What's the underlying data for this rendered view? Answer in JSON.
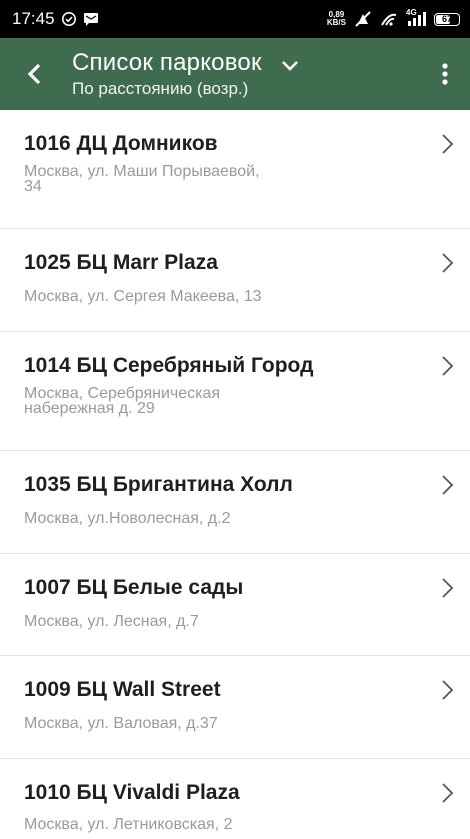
{
  "status_bar": {
    "time": "17:45",
    "net_speed_value": "0,89",
    "net_speed_unit": "KB/S",
    "signal_label": "4G",
    "battery": "67"
  },
  "appbar": {
    "title": "Список парковок",
    "subtitle": "По расстоянию (возр.)"
  },
  "parkings": [
    {
      "name": "1016 ДЦ Домников",
      "address_line1": "Москва, ул. Маши Порываевой,",
      "address_line2": "34"
    },
    {
      "name": "1025 БЦ Marr Plaza",
      "address_line1": "Москва, ул. Сергея Макеева, 13",
      "address_line2": ""
    },
    {
      "name": "1014 БЦ Серебряный Город",
      "address_line1": "Москва, Серебряническая",
      "address_line2": "набережная д. 29"
    },
    {
      "name": "1035 БЦ Бригантина Холл",
      "address_line1": "Москва, ул.Новолесная, д.2",
      "address_line2": ""
    },
    {
      "name": "1007 БЦ Белые сады",
      "address_line1": "Москва, ул. Лесная, д.7",
      "address_line2": ""
    },
    {
      "name": "1009 БЦ Wall Street",
      "address_line1": "Москва, ул. Валовая, д.37",
      "address_line2": ""
    },
    {
      "name": "1010 БЦ Vivaldi Plaza",
      "address_line1": "Москва, ул. Летниковская, 2",
      "address_line2": ""
    }
  ],
  "colors": {
    "appbar_bg": "#3f6b4f",
    "status_bg": "#000000",
    "address_text": "#9a9a9a"
  }
}
